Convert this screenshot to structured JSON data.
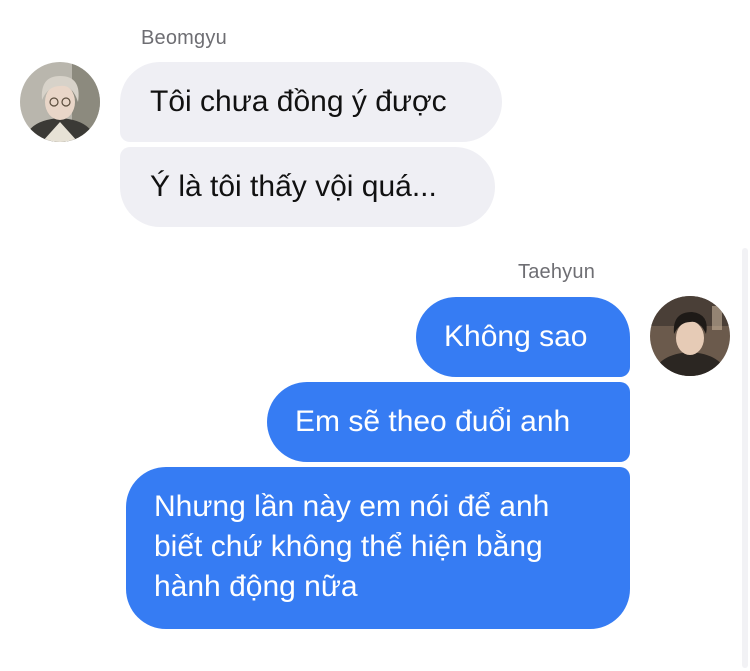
{
  "conversation": {
    "groups": [
      {
        "sender": "Beomgyu",
        "direction": "incoming",
        "messages": [
          "Tôi chưa đồng ý được",
          "Ý là tôi thấy vội quá..."
        ]
      },
      {
        "sender": "Taehyun",
        "direction": "outgoing",
        "messages": [
          "Không sao",
          "Em sẽ theo đuổi anh",
          "Nhưng lần này em nói để anh biết chứ không thể hiện bằng hành động nữa"
        ]
      }
    ]
  },
  "colors": {
    "outgoing_bubble": "#367cf3",
    "incoming_bubble": "#efeff4",
    "sender_name": "#6e6e73"
  }
}
